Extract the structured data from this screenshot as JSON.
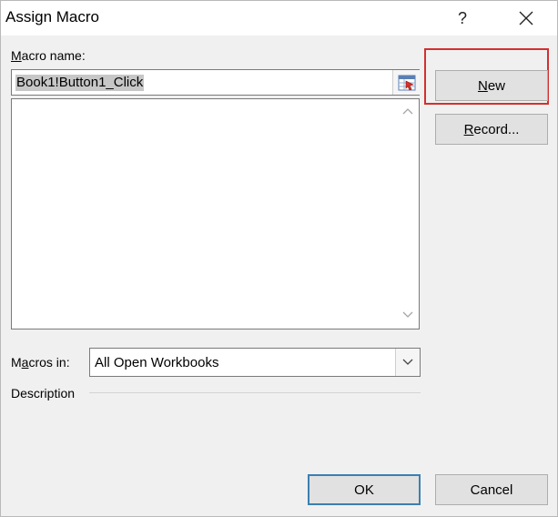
{
  "window": {
    "title": "Assign Macro",
    "help_label": "?",
    "close_icon": "close-icon"
  },
  "macro_name": {
    "label_prefix": "",
    "label_accel": "M",
    "label_rest": "acro name:",
    "value": "Book1!Button1_Click",
    "ref_icon": "range-reference-icon"
  },
  "macro_list": {
    "items": [],
    "scroll_up_icon": "chevron-up-icon",
    "scroll_down_icon": "chevron-down-icon"
  },
  "macros_in": {
    "label_prefix": "M",
    "label_accel": "a",
    "label_rest": "cros in:",
    "selected": "All Open Workbooks",
    "arrow_icon": "chevron-down-icon"
  },
  "description": {
    "label": "Description"
  },
  "buttons": {
    "new_accel": "N",
    "new_rest": "ew",
    "record_accel": "R",
    "record_rest": "ecord...",
    "ok": "OK",
    "cancel": "Cancel"
  },
  "colors": {
    "highlight": "#d32f2f",
    "default_button_border": "#3c7fb1",
    "dialog_background": "#f0f0f0"
  }
}
